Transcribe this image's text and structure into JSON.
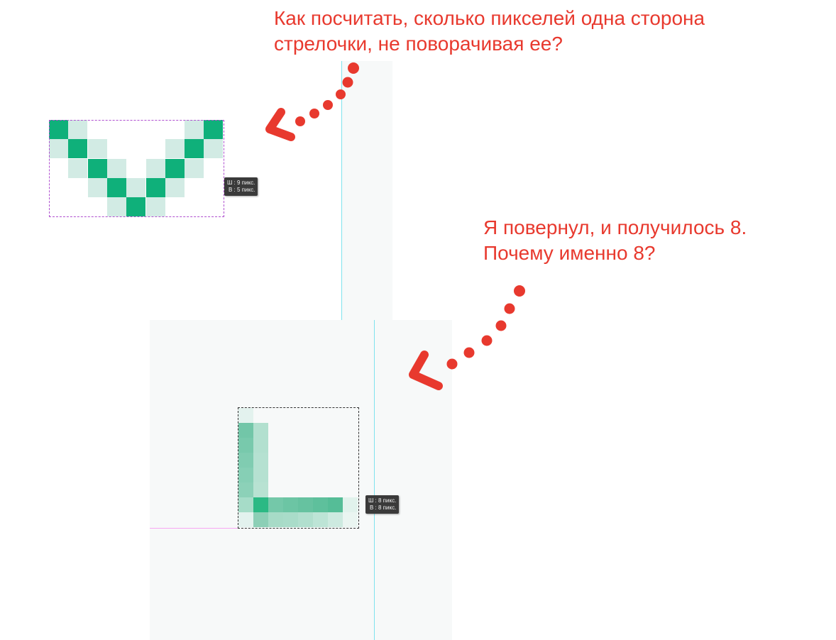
{
  "annotation_top": {
    "line1": "Как посчитать, сколько пикселей одна сторона",
    "line2": "стрелочки, не поворачивая ее?"
  },
  "annotation_bottom": {
    "line1": "Я повернул, и получилось 8.",
    "line2": "Почему именно 8?"
  },
  "tooltip_top": {
    "width": "Ш :  9 пикс.",
    "height": "В :  5 пикс."
  },
  "tooltip_bottom": {
    "width": "Ш :  8 пикс.",
    "height": "В :  8 пикс."
  },
  "colors": {
    "annotation": "#e8392e",
    "pixel_dark": "#0fb07a",
    "pixel_light": "#cfe9e1",
    "guide_cyan": "#7fe3ee",
    "guide_magenta": "#f7a6f3"
  },
  "icons": [
    "dotted-curved-arrow-icon",
    "dotted-curved-arrow-icon"
  ]
}
